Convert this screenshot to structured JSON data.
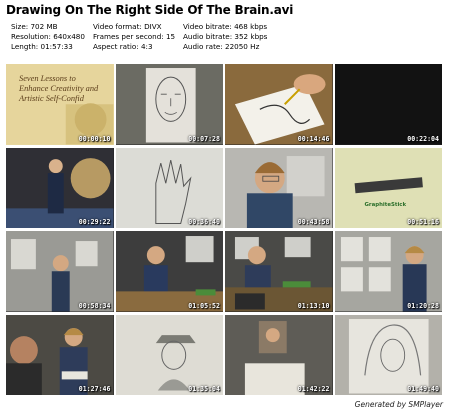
{
  "title": "Drawing On The Right Side Of The Brain.avi",
  "info": {
    "col1": [
      "Size: 702 MB",
      "Resolution: 640x480",
      "Length: 01:57:33"
    ],
    "col2": [
      "Video format: DIVX",
      "Frames per second: 15",
      "Aspect ratio: 4:3"
    ],
    "col3": [
      "Video bitrate: 468 kbps",
      "Audio bitrate: 352 kbps",
      "Audio rate: 22050 Hz"
    ]
  },
  "thumbnails": [
    {
      "time": "00:00:10",
      "scene": "title-card"
    },
    {
      "time": "00:07:28",
      "scene": "face-drawing"
    },
    {
      "time": "00:14:46",
      "scene": "hand-drawing-on-paper"
    },
    {
      "time": "00:22:04",
      "scene": "dark-frame"
    },
    {
      "time": "00:29:22",
      "scene": "presenter-standing"
    },
    {
      "time": "00:36:40",
      "scene": "hand-sketch"
    },
    {
      "time": "00:43:58",
      "scene": "presenter-closeup"
    },
    {
      "time": "00:51:16",
      "scene": "graphite-stick"
    },
    {
      "time": "00:58:34",
      "scene": "presenter-room"
    },
    {
      "time": "01:05:52",
      "scene": "presenter-at-table"
    },
    {
      "time": "01:13:10",
      "scene": "presenter-at-desk"
    },
    {
      "time": "01:20:28",
      "scene": "presenter-gallery"
    },
    {
      "time": "01:27:46",
      "scene": "two-people"
    },
    {
      "time": "01:35:04",
      "scene": "portrait-sketch"
    },
    {
      "time": "01:42:22",
      "scene": "held-portrait"
    },
    {
      "time": "01:49:40",
      "scene": "woman-sketch"
    }
  ],
  "title_card_text": "Seven Lessons to Enhance Creativity and Artistic Self-Confid",
  "graphite_label": "GraphiteStick",
  "footer": "Generated by SMPlayer"
}
